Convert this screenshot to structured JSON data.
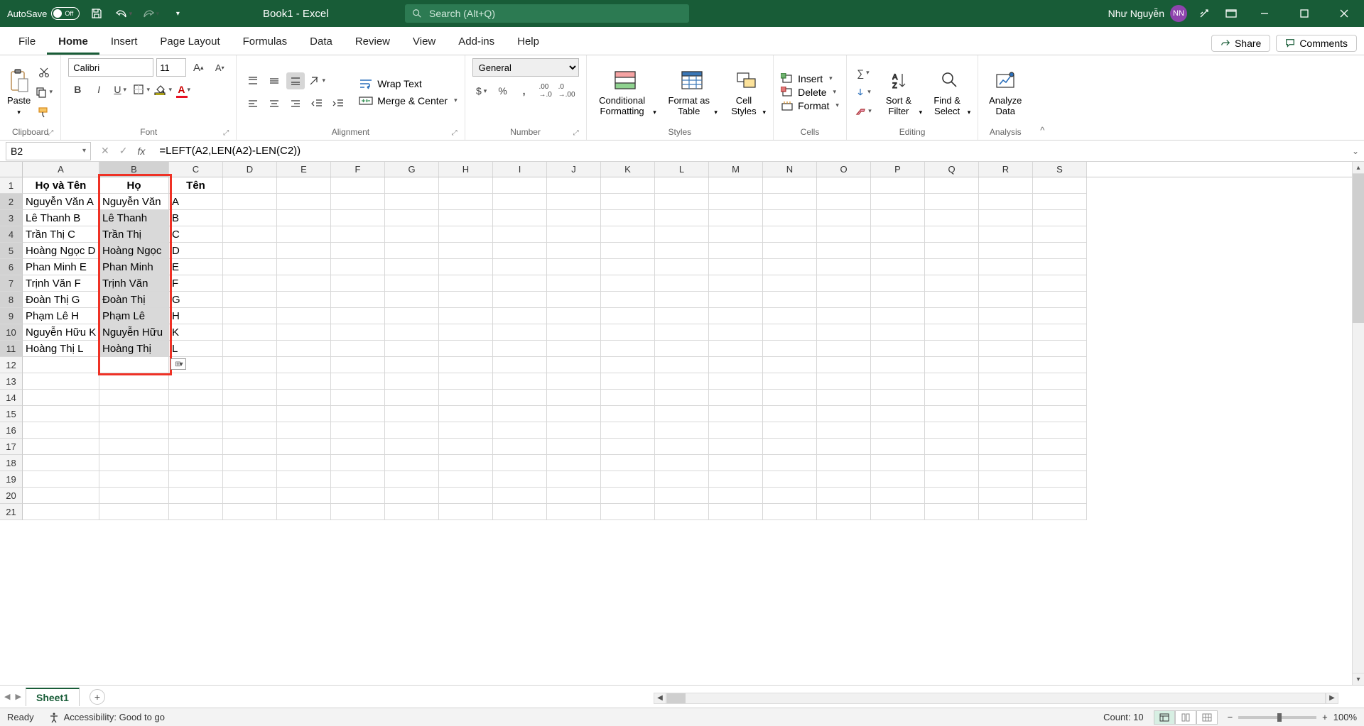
{
  "titlebar": {
    "autosave_label": "AutoSave",
    "autosave_state": "Off",
    "doc_title": "Book1  -  Excel",
    "search_placeholder": "Search (Alt+Q)",
    "user_name": "Như Nguyễn",
    "user_initials": "NN"
  },
  "tabs": [
    "File",
    "Home",
    "Insert",
    "Page Layout",
    "Formulas",
    "Data",
    "Review",
    "View",
    "Add-ins",
    "Help"
  ],
  "active_tab": "Home",
  "share_label": "Share",
  "comments_label": "Comments",
  "ribbon": {
    "clipboard": {
      "paste": "Paste",
      "group": "Clipboard"
    },
    "font": {
      "name": "Calibri",
      "size": "11",
      "group": "Font"
    },
    "alignment": {
      "wrap": "Wrap Text",
      "merge": "Merge & Center",
      "group": "Alignment"
    },
    "number": {
      "format": "General",
      "group": "Number"
    },
    "styles": {
      "cond": "Conditional Formatting",
      "fat": "Format as Table",
      "cell": "Cell Styles",
      "group": "Styles"
    },
    "cells": {
      "insert": "Insert",
      "delete": "Delete",
      "format": "Format",
      "group": "Cells"
    },
    "editing": {
      "sort": "Sort & Filter",
      "find": "Find & Select",
      "group": "Editing"
    },
    "analysis": {
      "analyze": "Analyze Data",
      "group": "Analysis"
    }
  },
  "namebox": "B2",
  "formula": "=LEFT(A2,LEN(A2)-LEN(C2))",
  "columns": [
    "A",
    "B",
    "C",
    "D",
    "E",
    "F",
    "G",
    "H",
    "I",
    "J",
    "K",
    "L",
    "M",
    "N",
    "O",
    "P",
    "Q",
    "R",
    "S"
  ],
  "col_widths": {
    "A": 108,
    "B": 98,
    "C": 76,
    "std": 76
  },
  "row_count": 21,
  "headers": {
    "A": "Họ và Tên",
    "B": "Họ",
    "C": "Tên"
  },
  "data_rows": [
    {
      "A": "Nguyễn Văn A",
      "B": "Nguyễn Văn ",
      "C": "A"
    },
    {
      "A": "Lê Thanh B",
      "B": "Lê Thanh ",
      "C": "B"
    },
    {
      "A": "Trần Thị C",
      "B": "Trần Thị ",
      "C": "C"
    },
    {
      "A": "Hoàng Ngọc D",
      "B": "Hoàng Ngọc ",
      "C": "D"
    },
    {
      "A": "Phan Minh E",
      "B": "Phan Minh ",
      "C": "E"
    },
    {
      "A": "Trịnh Văn F",
      "B": "Trịnh Văn ",
      "C": "F"
    },
    {
      "A": "Đoàn Thị G",
      "B": "Đoàn Thị ",
      "C": "G"
    },
    {
      "A": "Phạm Lê H",
      "B": "Phạm Lê ",
      "C": "H"
    },
    {
      "A": "Nguyễn Hữu K",
      "B": "Nguyễn Hữu ",
      "C": "K"
    },
    {
      "A": "Hoàng Thị L",
      "B": "Hoàng Thị ",
      "C": "L"
    }
  ],
  "selection": {
    "col": "B",
    "from_row": 2,
    "to_row": 11,
    "display_from_row": 3
  },
  "redbox": {
    "col": "B",
    "from_row": 1,
    "to_row": 12
  },
  "sheet": {
    "name": "Sheet1"
  },
  "status": {
    "ready": "Ready",
    "accessibility": "Accessibility: Good to go",
    "count_label": "Count:",
    "count_value": "10",
    "zoom": "100%"
  }
}
